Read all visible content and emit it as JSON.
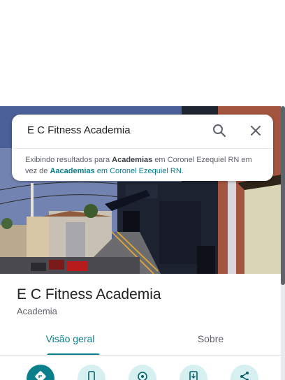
{
  "search": {
    "query": "E C Fitness Academia",
    "search_icon": "search-icon",
    "close_icon": "close-icon"
  },
  "notice": {
    "prefix": "Exibindo resultados para ",
    "shown_term": "Academias",
    "middle": " em Coronel Ezequiel RN em vez de ",
    "original_term": "Aacademias",
    "suffix": " em Coronel Ezequiel RN."
  },
  "place": {
    "name": "E C Fitness Academia",
    "category": "Academia"
  },
  "tabs": [
    {
      "label": "Visão geral",
      "active": true
    },
    {
      "label": "Sobre",
      "active": false
    }
  ],
  "actions": [
    {
      "icon": "directions-icon"
    },
    {
      "icon": "phone-icon"
    },
    {
      "icon": "nearby-icon"
    },
    {
      "icon": "save-to-phone-icon"
    },
    {
      "icon": "share-icon"
    }
  ],
  "colors": {
    "accent": "#0b7f8a",
    "accent_light": "#d6f0f1"
  }
}
